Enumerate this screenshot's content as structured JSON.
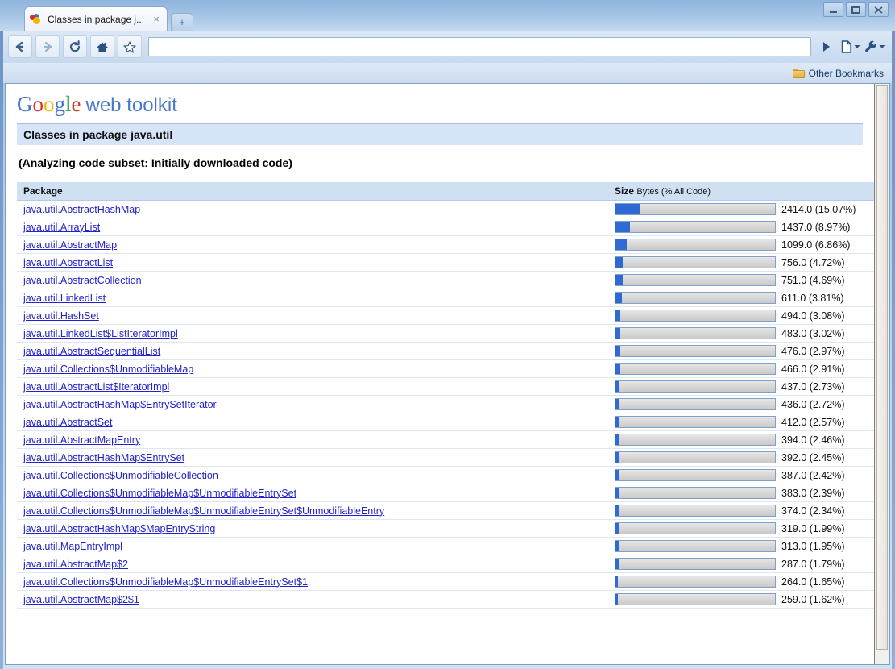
{
  "browser": {
    "tab": {
      "title": "Classes in package j...",
      "close_label": "×",
      "favicon": "gwt-favicon-icon"
    },
    "new_tab_label": "+",
    "window_controls": {
      "minimize": "minimize-icon",
      "maximize": "maximize-icon",
      "close": "close-icon"
    },
    "toolbar": {
      "back": "back-arrow-icon",
      "forward": "forward-arrow-icon",
      "reload": "reload-icon",
      "home": "home-icon",
      "bookmark": "star-icon",
      "go": "go-arrow-icon",
      "page_menu": "page-menu-icon",
      "wrench_menu": "wrench-menu-icon",
      "omnibox_value": "",
      "omnibox_placeholder": ""
    },
    "bookmarks_bar": {
      "other_bookmarks_label": "Other Bookmarks",
      "folder_icon": "folder-icon"
    }
  },
  "page": {
    "logo": {
      "g1": "G",
      "o1": "o",
      "o2": "o",
      "g2": "g",
      "l1": "l",
      "e1": "e",
      "wordmark": "web toolkit"
    },
    "title": "Classes in package java.util",
    "subset_note": "(Analyzing code subset: Initially downloaded code)",
    "table": {
      "headers": {
        "package": "Package",
        "size_main": "Size",
        "size_sub": "Bytes (% All Code)"
      },
      "rows": [
        {
          "package": "java.util.AbstractHashMap",
          "bytes": "2414.0",
          "percent": 15.07,
          "size_label": "2414.0 (15.07%)"
        },
        {
          "package": "java.util.ArrayList",
          "bytes": "1437.0",
          "percent": 8.97,
          "size_label": "1437.0 (8.97%)"
        },
        {
          "package": "java.util.AbstractMap",
          "bytes": "1099.0",
          "percent": 6.86,
          "size_label": "1099.0 (6.86%)"
        },
        {
          "package": "java.util.AbstractList",
          "bytes": "756.0",
          "percent": 4.72,
          "size_label": "756.0 (4.72%)"
        },
        {
          "package": "java.util.AbstractCollection",
          "bytes": "751.0",
          "percent": 4.69,
          "size_label": "751.0 (4.69%)"
        },
        {
          "package": "java.util.LinkedList",
          "bytes": "611.0",
          "percent": 3.81,
          "size_label": "611.0 (3.81%)"
        },
        {
          "package": "java.util.HashSet",
          "bytes": "494.0",
          "percent": 3.08,
          "size_label": "494.0 (3.08%)"
        },
        {
          "package": "java.util.LinkedList$ListIteratorImpl",
          "bytes": "483.0",
          "percent": 3.02,
          "size_label": "483.0 (3.02%)"
        },
        {
          "package": "java.util.AbstractSequentialList",
          "bytes": "476.0",
          "percent": 2.97,
          "size_label": "476.0 (2.97%)"
        },
        {
          "package": "java.util.Collections$UnmodifiableMap",
          "bytes": "466.0",
          "percent": 2.91,
          "size_label": "466.0 (2.91%)"
        },
        {
          "package": "java.util.AbstractList$IteratorImpl",
          "bytes": "437.0",
          "percent": 2.73,
          "size_label": "437.0 (2.73%)"
        },
        {
          "package": "java.util.AbstractHashMap$EntrySetIterator",
          "bytes": "436.0",
          "percent": 2.72,
          "size_label": "436.0 (2.72%)"
        },
        {
          "package": "java.util.AbstractSet",
          "bytes": "412.0",
          "percent": 2.57,
          "size_label": "412.0 (2.57%)"
        },
        {
          "package": "java.util.AbstractMapEntry",
          "bytes": "394.0",
          "percent": 2.46,
          "size_label": "394.0 (2.46%)"
        },
        {
          "package": "java.util.AbstractHashMap$EntrySet",
          "bytes": "392.0",
          "percent": 2.45,
          "size_label": "392.0 (2.45%)"
        },
        {
          "package": "java.util.Collections$UnmodifiableCollection",
          "bytes": "387.0",
          "percent": 2.42,
          "size_label": "387.0 (2.42%)"
        },
        {
          "package": "java.util.Collections$UnmodifiableMap$UnmodifiableEntrySet",
          "bytes": "383.0",
          "percent": 2.39,
          "size_label": "383.0 (2.39%)"
        },
        {
          "package": "java.util.Collections$UnmodifiableMap$UnmodifiableEntrySet$UnmodifiableEntry",
          "bytes": "374.0",
          "percent": 2.34,
          "size_label": "374.0 (2.34%)"
        },
        {
          "package": "java.util.AbstractHashMap$MapEntryString",
          "bytes": "319.0",
          "percent": 1.99,
          "size_label": "319.0 (1.99%)"
        },
        {
          "package": "java.util.MapEntryImpl",
          "bytes": "313.0",
          "percent": 1.95,
          "size_label": "313.0 (1.95%)"
        },
        {
          "package": "java.util.AbstractMap$2",
          "bytes": "287.0",
          "percent": 1.79,
          "size_label": "287.0 (1.79%)"
        },
        {
          "package": "java.util.Collections$UnmodifiableMap$UnmodifiableEntrySet$1",
          "bytes": "264.0",
          "percent": 1.65,
          "size_label": "264.0 (1.65%)"
        },
        {
          "package": "java.util.AbstractMap$2$1",
          "bytes": "259.0",
          "percent": 1.62,
          "size_label": "259.0 (1.62%)"
        }
      ]
    }
  }
}
